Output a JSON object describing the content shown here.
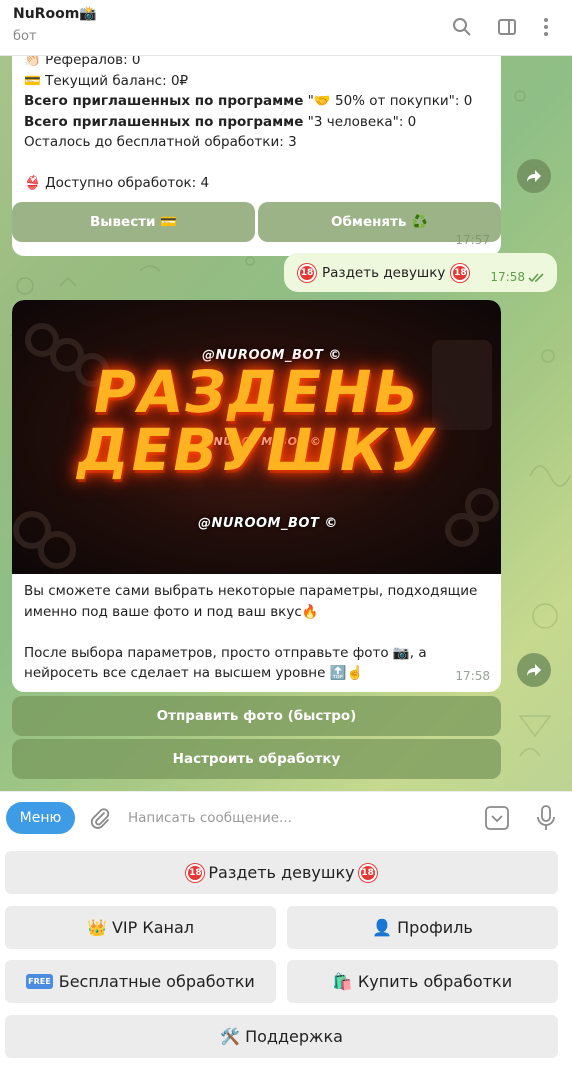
{
  "header": {
    "title": "NuRoom📸",
    "subtitle": "бот"
  },
  "message1": {
    "referrals": "👏🏻 Рефералов: 0",
    "balance": "💳 Текущий баланс: 0₽",
    "program1_bold": "Всего приглашенных по программе",
    "program1_rest": " \"🤝 50% от покупки\": 0",
    "program2_bold": "Всего приглашенных по программе",
    "program2_rest": " \"3 человека\": 0",
    "remaining": "Осталось до бесплатной обработки: 3",
    "available": "👙 Доступно обработок: 4",
    "time": "17:57"
  },
  "inline1": {
    "withdraw": "Вывести 💳",
    "exchange": "Обменять ♻️"
  },
  "outgoing": {
    "text": "Раздеть девушку",
    "time": "17:58"
  },
  "message2": {
    "banner_watermark": "@NUROOM_BOT ©",
    "banner_line1": "РАЗДЕНЬ",
    "banner_line2": "ДЕВУШКУ",
    "para1": "Вы сможете сами выбрать некоторые параметры, подходящие именно под ваше фото и под ваш вкус🔥",
    "para2": "После выбора параметров, просто отправьте фото 📷, а нейросеть все сделает на высшем уровне 🔝☝️",
    "time": "17:58"
  },
  "inline2": {
    "send_photo": "Отправить фото (быстро)",
    "configure": "Настроить обработку"
  },
  "input": {
    "menu_label": "Меню",
    "placeholder": "Написать сообщение..."
  },
  "keyboard": {
    "undress": "Раздеть девушку",
    "vip": "👑 VIP Канал",
    "profile": "👤 Профиль",
    "free": "Бесплатные обработки",
    "free_badge": "FREE",
    "buy": "🛍️ Купить обработки",
    "support": "🛠️ Поддержка",
    "badge18": "18"
  }
}
